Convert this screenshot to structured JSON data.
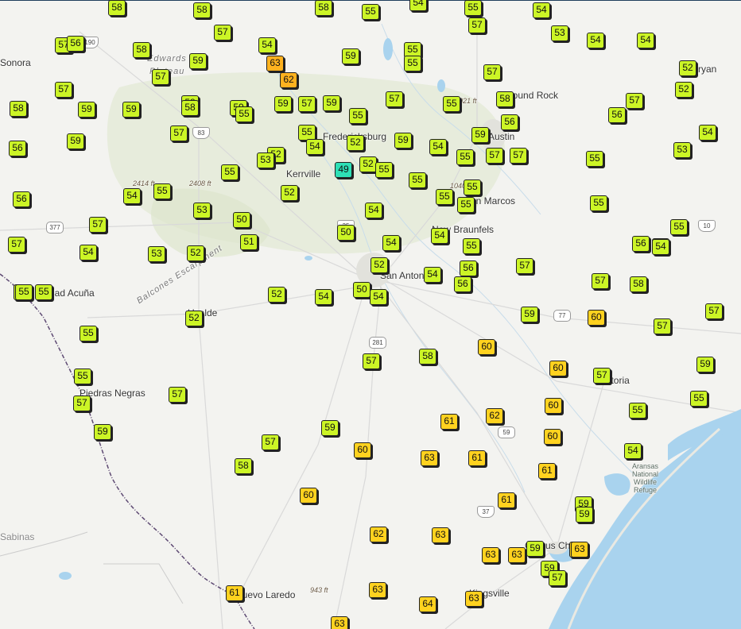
{
  "map": {
    "colors": {
      "land": "#f3f3f0",
      "water": "#a9d3ee",
      "border": "#5e4a73",
      "road": "#d6d6d6",
      "hill": "#dfe7cf",
      "marker_green": "#ccf526",
      "marker_yellow": "#ffd21f",
      "marker_orange": "#ffb21f",
      "marker_teal": "#2ee0b6"
    },
    "labels": [
      {
        "text": "Edwards",
        "kind": "region"
      },
      {
        "text": "Plateau",
        "kind": "region"
      },
      {
        "text": "Balcones Escarpment",
        "kind": "region"
      },
      {
        "text": "Fredericksburg",
        "kind": "city"
      },
      {
        "text": "Kerrville",
        "kind": "city"
      },
      {
        "text": "Austin",
        "kind": "city"
      },
      {
        "text": "Round Rock",
        "kind": "city"
      },
      {
        "text": "San Marcos",
        "kind": "city"
      },
      {
        "text": "New Braunfels",
        "kind": "city"
      },
      {
        "text": "San Antonio",
        "kind": "city"
      },
      {
        "text": "Ciudad Acuña",
        "kind": "city"
      },
      {
        "text": "Uvalde",
        "kind": "city"
      },
      {
        "text": "Piedras Negras",
        "kind": "city"
      },
      {
        "text": "Victoria",
        "kind": "city"
      },
      {
        "text": "Corpus Christi",
        "kind": "city"
      },
      {
        "text": "Kingsville",
        "kind": "city"
      },
      {
        "text": "Nuevo Laredo",
        "kind": "city"
      },
      {
        "text": "Sabinas",
        "kind": "city"
      },
      {
        "text": "Bryan",
        "kind": "city"
      },
      {
        "text": "Sonora",
        "kind": "city"
      },
      {
        "text": "2414 ft",
        "kind": "elev"
      },
      {
        "text": "2408 ft",
        "kind": "elev"
      },
      {
        "text": "1021 ft",
        "kind": "elev"
      },
      {
        "text": "1040 ft",
        "kind": "elev"
      },
      {
        "text": "943 ft",
        "kind": "elev"
      },
      {
        "text": "Aransas\nNational\nWildlife\nRefuge",
        "kind": "water"
      }
    ],
    "shields": [
      "190",
      "83",
      "377",
      "35",
      "10",
      "281",
      "77",
      "59",
      "37"
    ],
    "readings": [
      {
        "value": "58",
        "level": "g"
      },
      {
        "value": "58",
        "level": "g"
      },
      {
        "value": "58",
        "level": "g"
      },
      {
        "value": "55",
        "level": "g"
      },
      {
        "value": "54",
        "level": "g"
      },
      {
        "value": "55",
        "level": "g"
      },
      {
        "value": "54",
        "level": "g"
      },
      {
        "value": "57",
        "level": "g"
      },
      {
        "value": "56",
        "level": "g"
      },
      {
        "value": "53",
        "level": "g"
      },
      {
        "value": "54",
        "level": "g"
      },
      {
        "value": "54",
        "level": "g"
      },
      {
        "value": "57",
        "level": "g"
      },
      {
        "value": "54",
        "level": "g"
      },
      {
        "value": "57",
        "level": "g"
      },
      {
        "value": "58",
        "level": "g"
      },
      {
        "value": "63",
        "level": "o"
      },
      {
        "value": "59",
        "level": "g"
      },
      {
        "value": "55",
        "level": "g"
      },
      {
        "value": "52",
        "level": "g"
      },
      {
        "value": "59",
        "level": "g"
      },
      {
        "value": "55",
        "level": "g"
      },
      {
        "value": "57",
        "level": "g"
      },
      {
        "value": "62",
        "level": "o"
      },
      {
        "value": "57",
        "level": "g"
      },
      {
        "value": "52",
        "level": "g"
      },
      {
        "value": "57",
        "level": "g"
      },
      {
        "value": "58",
        "level": "g"
      },
      {
        "value": "59",
        "level": "g"
      },
      {
        "value": "59",
        "level": "g"
      },
      {
        "value": "58",
        "level": "g"
      },
      {
        "value": "59",
        "level": "g"
      },
      {
        "value": "59",
        "level": "g"
      },
      {
        "value": "57",
        "level": "g"
      },
      {
        "value": "59",
        "level": "g"
      },
      {
        "value": "57",
        "level": "g"
      },
      {
        "value": "55",
        "level": "g"
      },
      {
        "value": "58",
        "level": "g"
      },
      {
        "value": "57",
        "level": "g"
      },
      {
        "value": "55",
        "level": "g"
      },
      {
        "value": "58",
        "level": "g"
      },
      {
        "value": "55",
        "level": "g"
      },
      {
        "value": "56",
        "level": "g"
      },
      {
        "value": "56",
        "level": "g"
      },
      {
        "value": "56",
        "level": "g"
      },
      {
        "value": "59",
        "level": "g"
      },
      {
        "value": "57",
        "level": "g"
      },
      {
        "value": "55",
        "level": "g"
      },
      {
        "value": "54",
        "level": "g"
      },
      {
        "value": "52",
        "level": "g"
      },
      {
        "value": "59",
        "level": "g"
      },
      {
        "value": "54",
        "level": "g"
      },
      {
        "value": "59",
        "level": "g"
      },
      {
        "value": "54",
        "level": "g"
      },
      {
        "value": "52",
        "level": "g"
      },
      {
        "value": "53",
        "level": "g"
      },
      {
        "value": "55",
        "level": "g"
      },
      {
        "value": "57",
        "level": "g"
      },
      {
        "value": "57",
        "level": "g"
      },
      {
        "value": "55",
        "level": "g"
      },
      {
        "value": "55",
        "level": "g"
      },
      {
        "value": "53",
        "level": "g"
      },
      {
        "value": "49",
        "level": "c"
      },
      {
        "value": "52",
        "level": "g"
      },
      {
        "value": "55",
        "level": "g"
      },
      {
        "value": "55",
        "level": "g"
      },
      {
        "value": "54",
        "level": "g"
      },
      {
        "value": "55",
        "level": "g"
      },
      {
        "value": "52",
        "level": "g"
      },
      {
        "value": "55",
        "level": "g"
      },
      {
        "value": "55",
        "level": "g"
      },
      {
        "value": "56",
        "level": "g"
      },
      {
        "value": "53",
        "level": "g"
      },
      {
        "value": "55",
        "level": "g"
      },
      {
        "value": "55",
        "level": "g"
      },
      {
        "value": "54",
        "level": "g"
      },
      {
        "value": "57",
        "level": "g"
      },
      {
        "value": "50",
        "level": "g"
      },
      {
        "value": "54",
        "level": "g"
      },
      {
        "value": "54",
        "level": "g"
      },
      {
        "value": "57",
        "level": "g"
      },
      {
        "value": "50",
        "level": "g"
      },
      {
        "value": "55",
        "level": "g"
      },
      {
        "value": "54",
        "level": "g"
      },
      {
        "value": "55",
        "level": "g"
      },
      {
        "value": "56",
        "level": "g"
      },
      {
        "value": "54",
        "level": "g"
      },
      {
        "value": "54",
        "level": "g"
      },
      {
        "value": "53",
        "level": "g"
      },
      {
        "value": "52",
        "level": "g"
      },
      {
        "value": "51",
        "level": "g"
      },
      {
        "value": "52",
        "level": "g"
      },
      {
        "value": "56",
        "level": "g"
      },
      {
        "value": "57",
        "level": "g"
      },
      {
        "value": "55",
        "level": "g"
      },
      {
        "value": "55",
        "level": "g"
      },
      {
        "value": "55",
        "level": "g"
      },
      {
        "value": "52",
        "level": "g"
      },
      {
        "value": "54",
        "level": "g"
      },
      {
        "value": "50",
        "level": "g"
      },
      {
        "value": "54",
        "level": "g"
      },
      {
        "value": "54",
        "level": "g"
      },
      {
        "value": "56",
        "level": "g"
      },
      {
        "value": "57",
        "level": "g"
      },
      {
        "value": "58",
        "level": "g"
      },
      {
        "value": "52",
        "level": "g"
      },
      {
        "value": "59",
        "level": "g"
      },
      {
        "value": "60",
        "level": "y"
      },
      {
        "value": "57",
        "level": "g"
      },
      {
        "value": "57",
        "level": "g"
      },
      {
        "value": "55",
        "level": "g"
      },
      {
        "value": "57",
        "level": "g"
      },
      {
        "value": "58",
        "level": "g"
      },
      {
        "value": "60",
        "level": "y"
      },
      {
        "value": "59",
        "level": "g"
      },
      {
        "value": "55",
        "level": "g"
      },
      {
        "value": "57",
        "level": "g"
      },
      {
        "value": "60",
        "level": "y"
      },
      {
        "value": "57",
        "level": "g"
      },
      {
        "value": "57",
        "level": "g"
      },
      {
        "value": "61",
        "level": "y"
      },
      {
        "value": "62",
        "level": "y"
      },
      {
        "value": "60",
        "level": "y"
      },
      {
        "value": "55",
        "level": "g"
      },
      {
        "value": "55",
        "level": "g"
      },
      {
        "value": "59",
        "level": "g"
      },
      {
        "value": "59",
        "level": "g"
      },
      {
        "value": "60",
        "level": "y"
      },
      {
        "value": "57",
        "level": "g"
      },
      {
        "value": "60",
        "level": "y"
      },
      {
        "value": "63",
        "level": "y"
      },
      {
        "value": "61",
        "level": "y"
      },
      {
        "value": "54",
        "level": "g"
      },
      {
        "value": "58",
        "level": "g"
      },
      {
        "value": "61",
        "level": "y"
      },
      {
        "value": "60",
        "level": "y"
      },
      {
        "value": "61",
        "level": "y"
      },
      {
        "value": "59",
        "level": "g"
      },
      {
        "value": "59",
        "level": "g"
      },
      {
        "value": "62",
        "level": "y"
      },
      {
        "value": "63",
        "level": "y"
      },
      {
        "value": "63",
        "level": "y"
      },
      {
        "value": "63",
        "level": "y"
      },
      {
        "value": "59",
        "level": "g"
      },
      {
        "value": "61",
        "level": "y"
      },
      {
        "value": "61",
        "level": "y"
      },
      {
        "value": "63",
        "level": "y"
      },
      {
        "value": "64",
        "level": "y"
      },
      {
        "value": "63",
        "level": "y"
      },
      {
        "value": "59",
        "level": "g"
      },
      {
        "value": "57",
        "level": "g"
      },
      {
        "value": "63",
        "level": "y"
      },
      {
        "value": "63",
        "level": "y"
      }
    ]
  }
}
